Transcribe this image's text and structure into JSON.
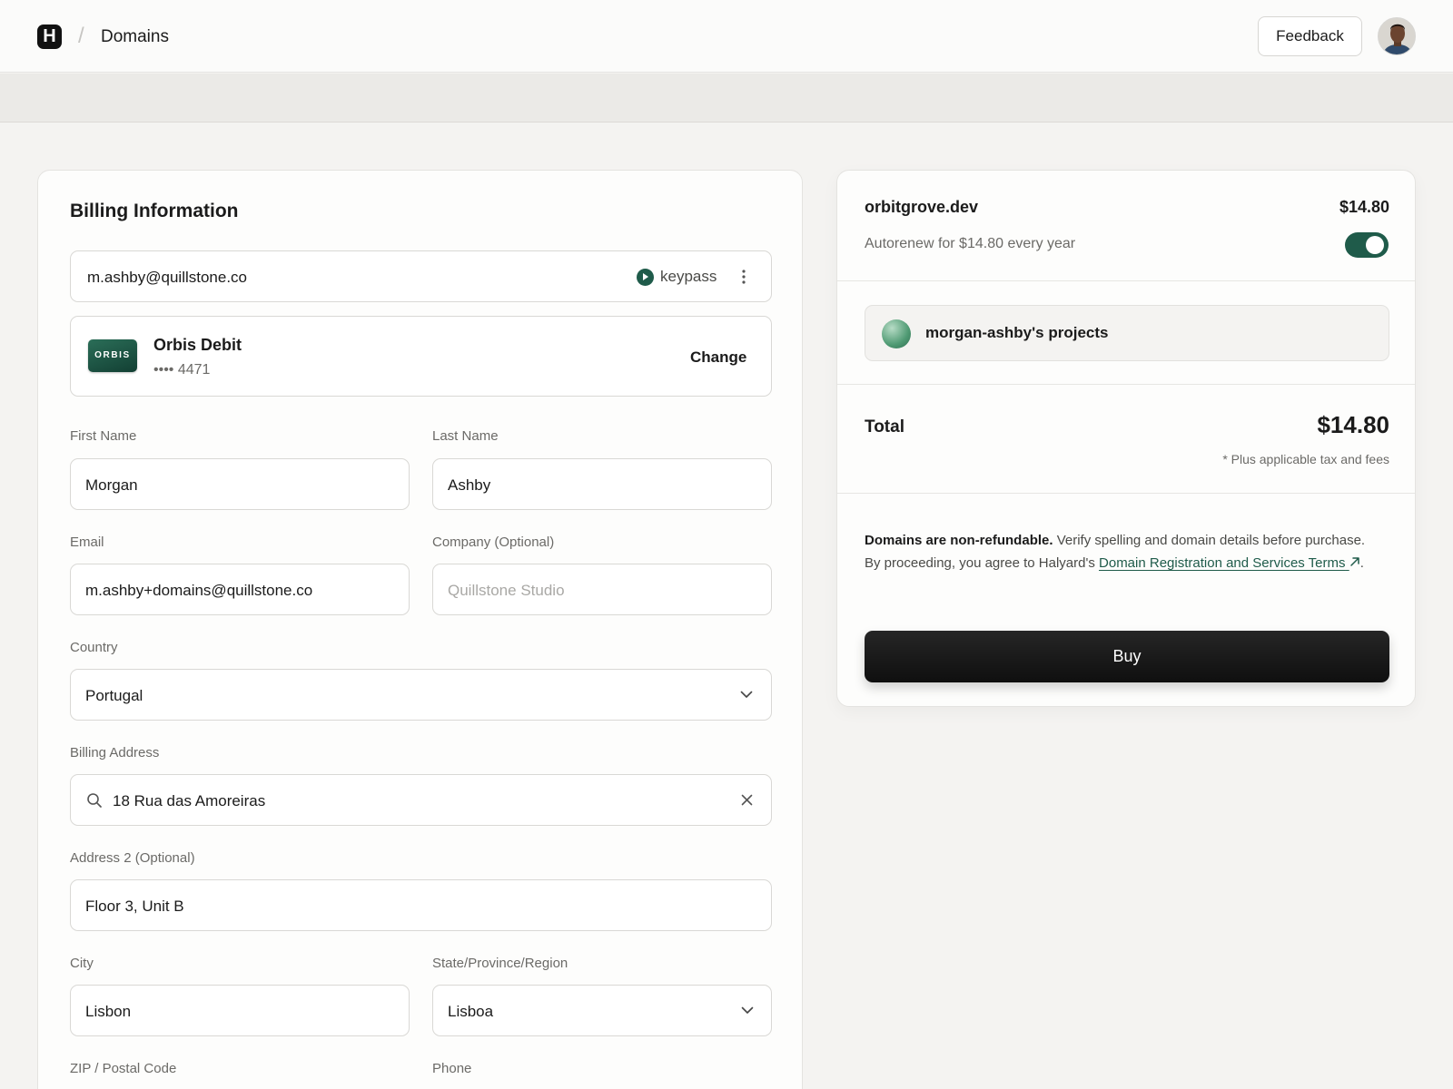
{
  "topbar": {
    "logo_letter": "H",
    "separator": "/",
    "breadcrumb": "Domains",
    "feedback_label": "Feedback"
  },
  "billing": {
    "title": "Billing Information",
    "account_email": "m.ashby@quillstone.co",
    "keypass_label": "keypass",
    "card": {
      "brand_badge": "ORBIS",
      "name": "Orbis Debit",
      "masked": "•••• 4471",
      "change_label": "Change"
    },
    "fields": {
      "first_name": {
        "label": "First Name",
        "value": "Morgan"
      },
      "last_name": {
        "label": "Last Name",
        "value": "Ashby"
      },
      "email": {
        "label": "Email",
        "value": "m.ashby+domains@quillstone.co"
      },
      "company": {
        "label": "Company (Optional)",
        "placeholder": "Quillstone Studio"
      },
      "country": {
        "label": "Country",
        "value": "Portugal"
      },
      "billing_address": {
        "label": "Billing Address",
        "value": "18 Rua das Amoreiras"
      },
      "address2": {
        "label": "Address 2 (Optional)",
        "value": "Floor 3, Unit B"
      },
      "city": {
        "label": "City",
        "value": "Lisbon"
      },
      "state": {
        "label": "State/Province/Region",
        "value": "Lisboa"
      },
      "zip": {
        "label": "ZIP / Postal Code"
      },
      "phone": {
        "label": "Phone"
      }
    }
  },
  "summary": {
    "domain": "orbitgrove.dev",
    "price": "$14.80",
    "autorenew_text": "Autorenew for $14.80 every year",
    "autorenew_on": true,
    "project": "morgan-ashby's projects",
    "total_label": "Total",
    "total_value": "$14.80",
    "tax_note": "* Plus applicable tax and fees",
    "legal": {
      "bold": "Domains are non-refundable.",
      "text": " Verify spelling and domain details before purchase. By proceeding, you agree to Halyard's ",
      "link": "Domain Registration and Services Terms",
      "end": "."
    },
    "buy_label": "Buy"
  },
  "colors": {
    "accent": "#1f5b4a",
    "background": "#f4f3f1",
    "card": "#fdfdfc",
    "button_dark": "#141414"
  }
}
